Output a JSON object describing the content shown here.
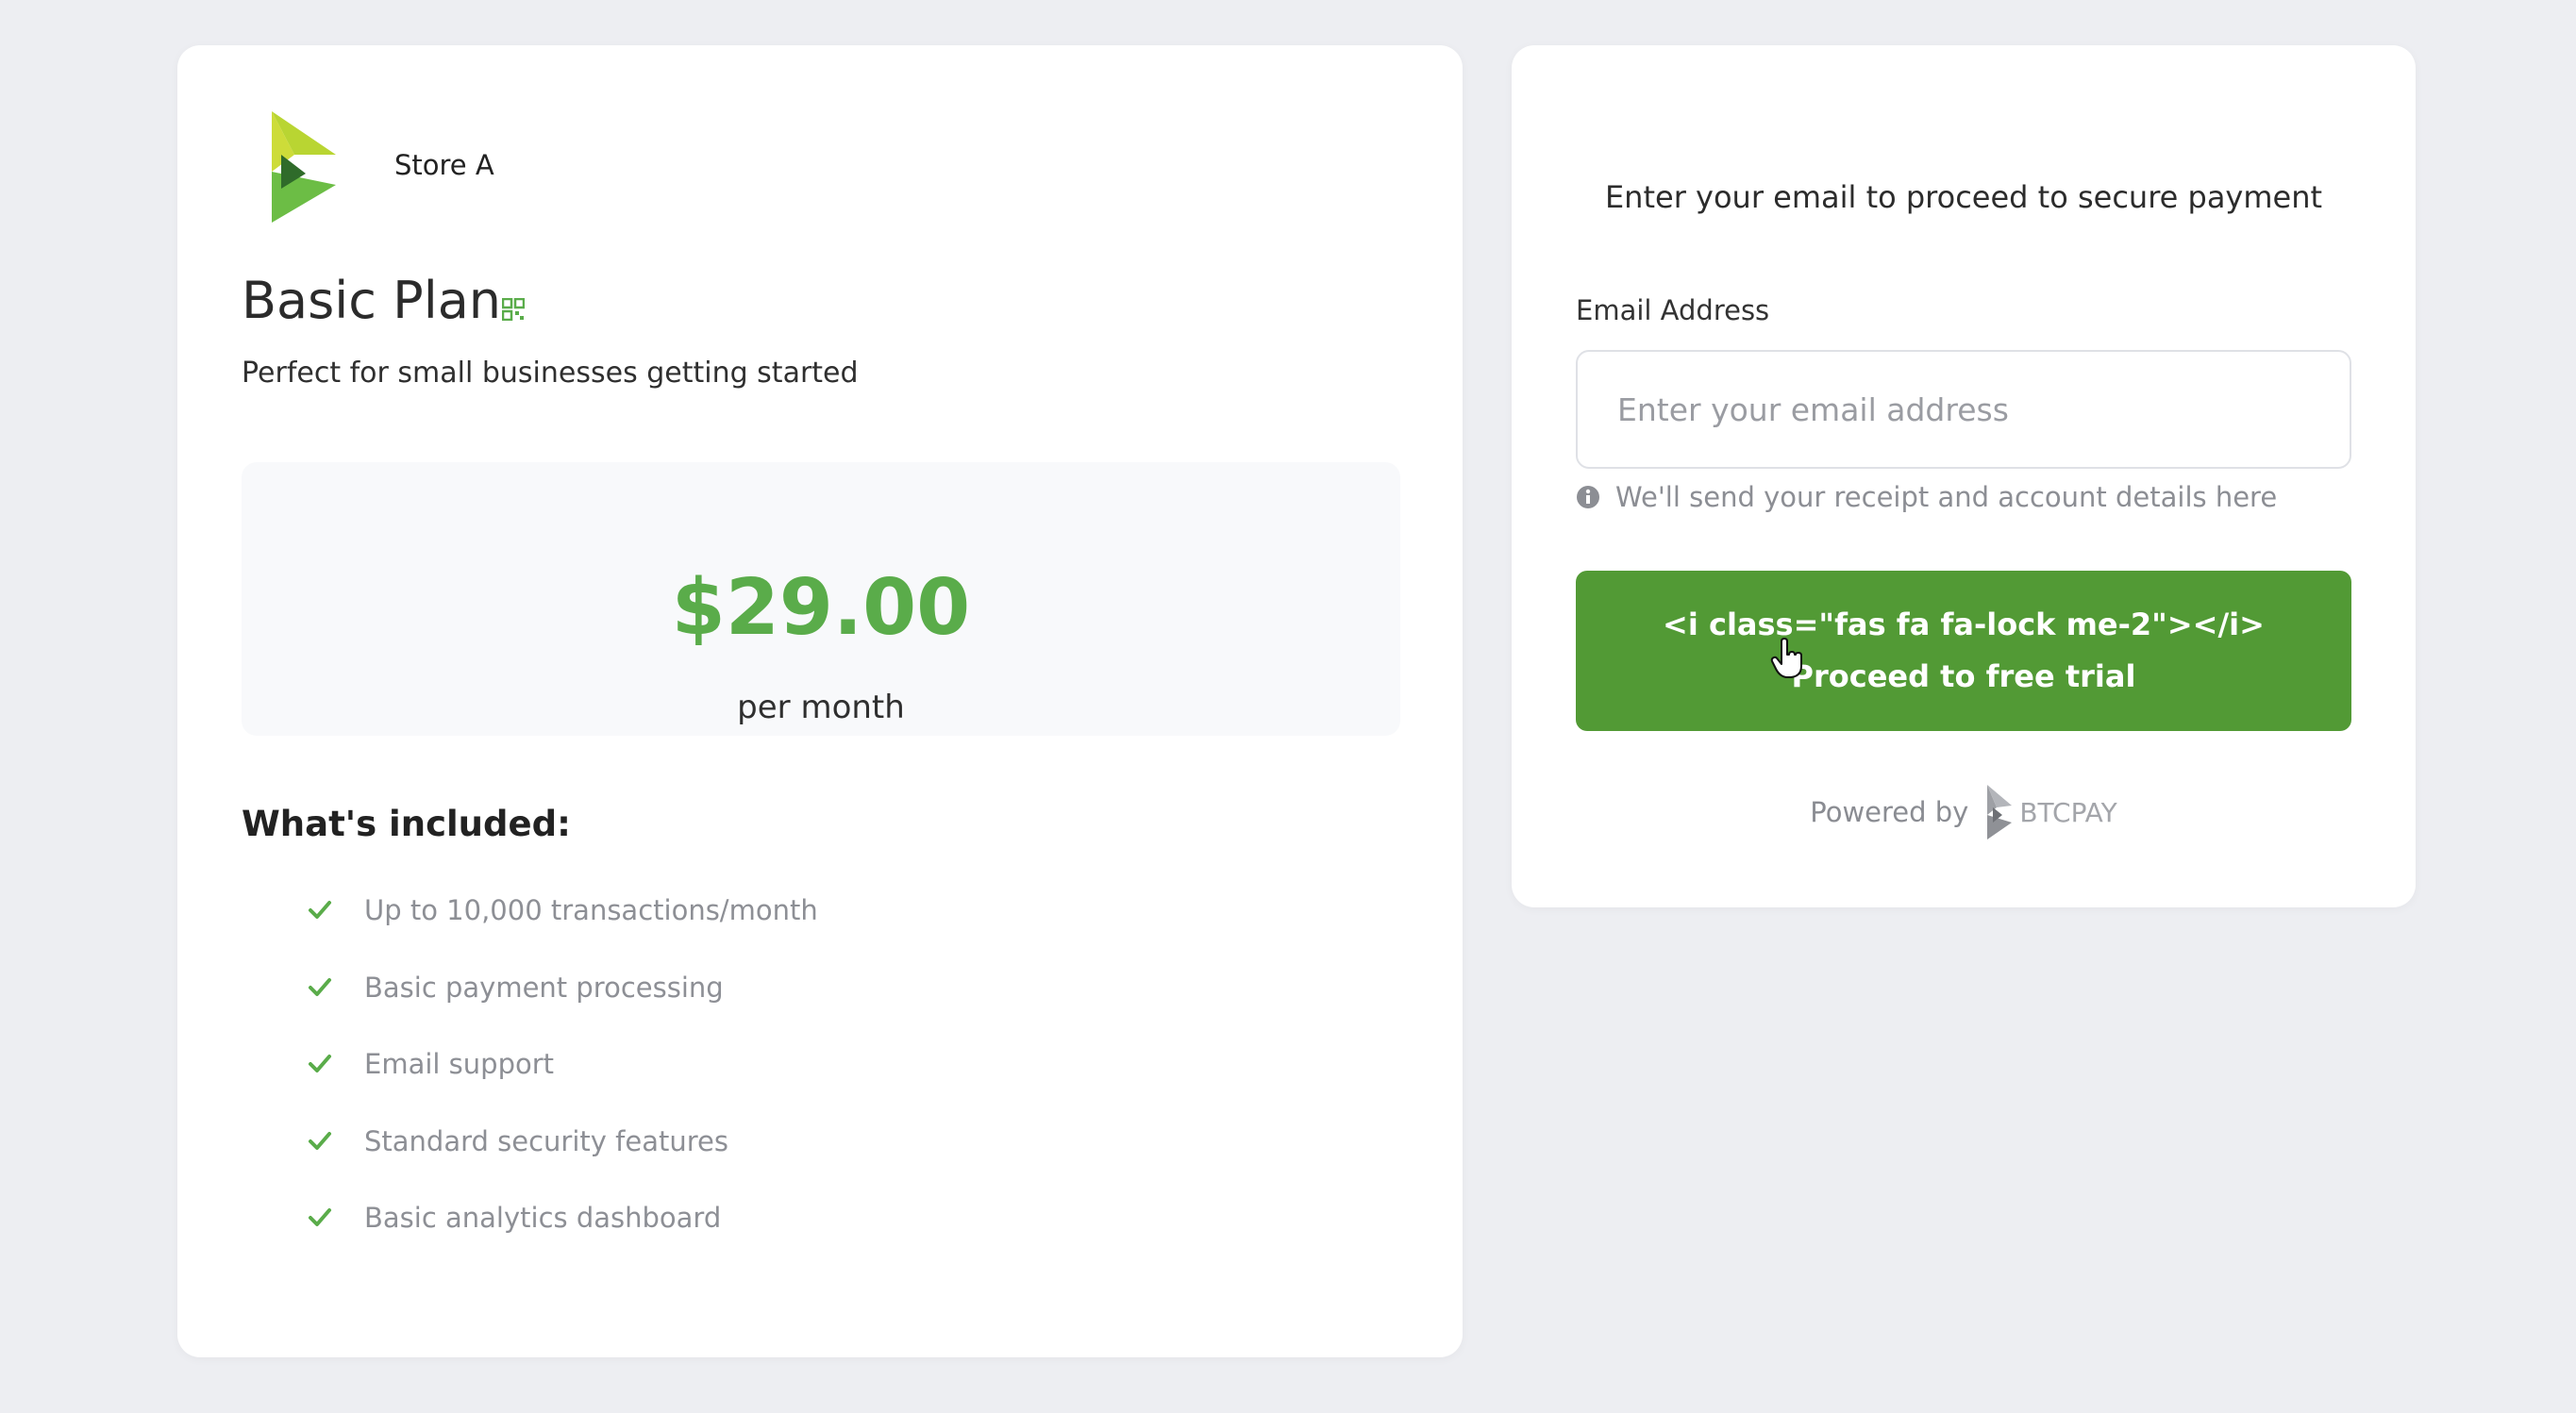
{
  "store": {
    "name": "Store A",
    "logo_icon": "btcpay-logo-icon"
  },
  "plan": {
    "title": "Basic Plan",
    "title_icon": "qr-code-icon",
    "description": "Perfect for small businesses getting started",
    "price": "$29.00",
    "period": "per month"
  },
  "included": {
    "heading": "What's included:",
    "features": [
      "Up to 10,000 transactions/month",
      "Basic payment processing",
      "Email support",
      "Standard security features",
      "Basic analytics dashboard"
    ]
  },
  "checkout": {
    "intro": "Enter your email to proceed to secure payment",
    "email_label": "Email Address",
    "email_placeholder": "Enter your email address",
    "email_value": "",
    "hint": "We'll send your receipt and account details here",
    "button_line1": "<i class=\"fas fa fa-lock me-2\"></i>",
    "button_line2": "Proceed to free trial",
    "powered_by": "Powered by",
    "brand": "BTCPAY"
  },
  "colors": {
    "accent": "#5aac4a",
    "button": "#529a35",
    "background": "#edeef2"
  }
}
